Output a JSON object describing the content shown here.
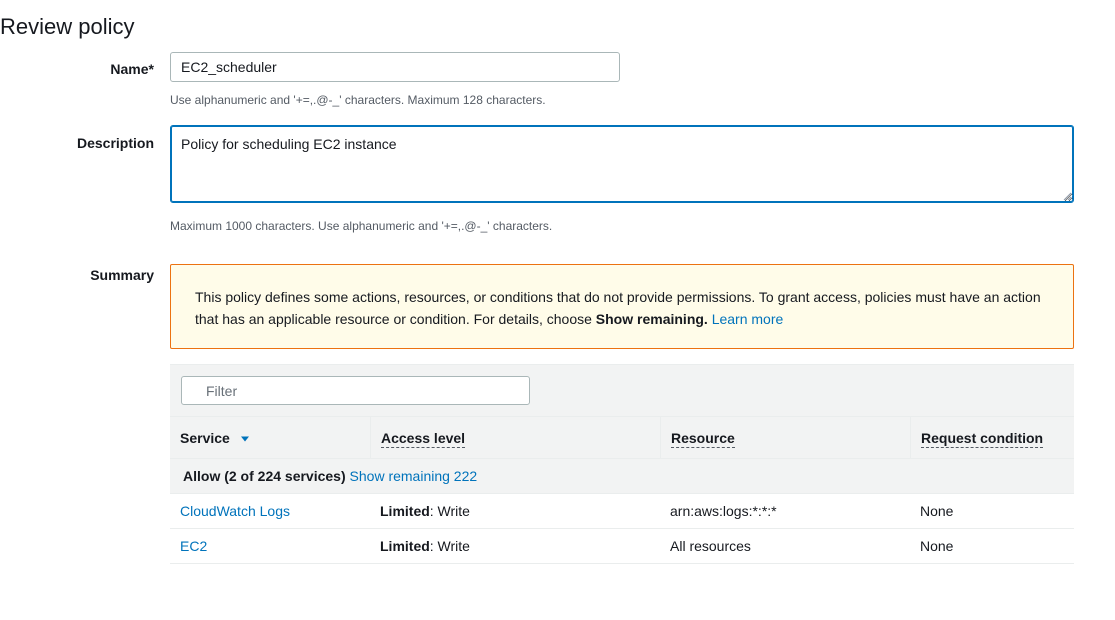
{
  "page": {
    "title": "Review policy"
  },
  "form": {
    "name_label": "Name*",
    "name_value": "EC2_scheduler",
    "name_hint": "Use alphanumeric and '+=,.@-_' characters. Maximum 128 characters.",
    "description_label": "Description",
    "description_value": "Policy for scheduling EC2 instance",
    "description_hint": "Maximum 1000 characters. Use alphanumeric and '+=,.@-_' characters.",
    "summary_label": "Summary"
  },
  "alert": {
    "text_before": "This policy defines some actions, resources, or conditions that do not provide permissions. To grant access, policies must have an action that has an applicable resource or condition. For details, choose ",
    "bold_text": "Show remaining.",
    "link_text": "Learn more"
  },
  "table": {
    "filter_placeholder": "Filter",
    "columns": [
      "Service",
      "Access level",
      "Resource",
      "Request condition"
    ],
    "group": {
      "label": "Allow (2 of 224 services)",
      "link": "Show remaining 222"
    },
    "rows": [
      {
        "service": "CloudWatch Logs",
        "access_bold": "Limited",
        "access_rest": ": Write",
        "resource": "arn:aws:logs:*:*:*",
        "condition": "None"
      },
      {
        "service": "EC2",
        "access_bold": "Limited",
        "access_rest": ": Write",
        "resource": "All resources",
        "condition": "None"
      }
    ]
  },
  "icons": {
    "search": "search-icon",
    "sort": "sort-desc-icon",
    "resize": "resize-grip-icon"
  },
  "colors": {
    "link": "#0073bb",
    "alert_border": "#ec7211",
    "alert_bg": "#fffce9",
    "focus": "#0073bb"
  }
}
